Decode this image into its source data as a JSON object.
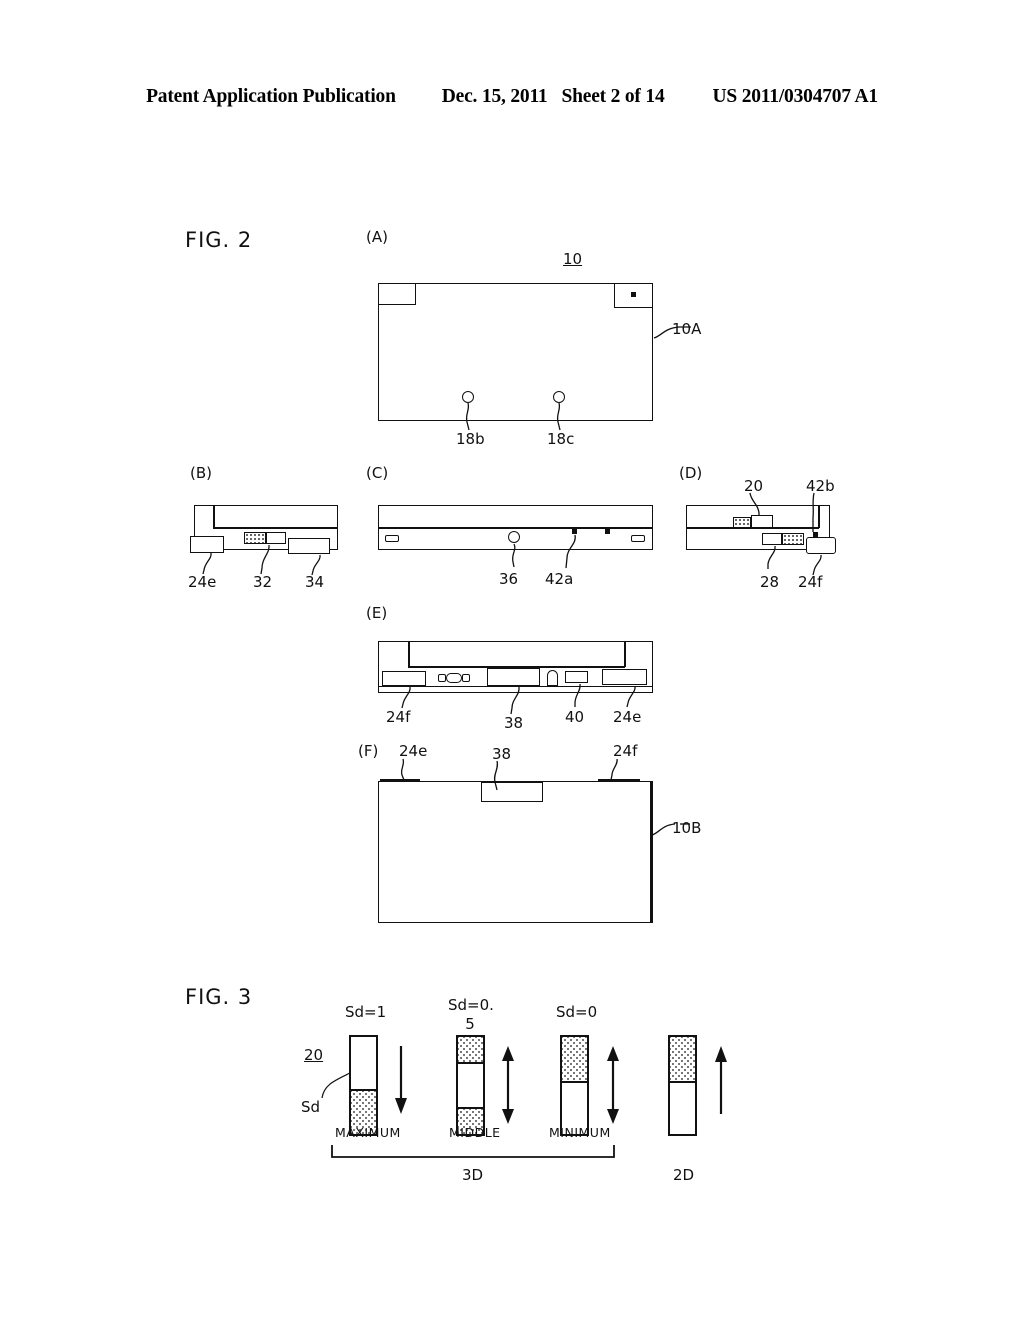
{
  "header": {
    "publication": "Patent Application Publication",
    "date": "Dec. 15, 2011",
    "sheet": "Sheet 2 of 14",
    "patent_number": "US 2011/0304707 A1"
  },
  "figures": [
    {
      "id": "fig2",
      "label": "FIG. 2",
      "panels": [
        {
          "key": "A",
          "label": "(A)",
          "refs": [
            "10",
            "10A",
            "18b",
            "18c"
          ]
        },
        {
          "key": "B",
          "label": "(B)",
          "refs": [
            "24e",
            "32",
            "34"
          ]
        },
        {
          "key": "C",
          "label": "(C)",
          "refs": [
            "36",
            "42a"
          ]
        },
        {
          "key": "D",
          "label": "(D)",
          "refs": [
            "20",
            "42b",
            "28",
            "24f"
          ]
        },
        {
          "key": "E",
          "label": "(E)",
          "refs": [
            "24f",
            "38",
            "40",
            "24e"
          ]
        },
        {
          "key": "F",
          "label": "(F)",
          "refs": [
            "24e",
            "38",
            "24f",
            "10B"
          ]
        }
      ]
    },
    {
      "id": "fig3",
      "label": "FIG. 3",
      "refs": [
        "20",
        "Sd"
      ],
      "group_labels": {
        "three_d": "3D",
        "two_d": "2D"
      },
      "sliders": [
        {
          "value_label": "Sd=1",
          "value_label_line2": "",
          "state": "MAXIMUM",
          "arrow": "down"
        },
        {
          "value_label": "Sd=0.",
          "value_label_line2": "5",
          "state": "MIDDLE",
          "arrow": "updown"
        },
        {
          "value_label": "Sd=0",
          "value_label_line2": "",
          "state": "MINIMUM",
          "arrow": "updown"
        },
        {
          "value_label": "",
          "value_label_line2": "",
          "state": "",
          "arrow": "up"
        }
      ]
    }
  ],
  "fig2": {
    "label": "FIG. 2",
    "panelA": {
      "label": "(A)",
      "ref_body": "10",
      "ref_face": "10A",
      "ref_hole_left": "18b",
      "ref_hole_right": "18c"
    },
    "panelB": {
      "label": "(B)",
      "ref_left": "24e",
      "ref_mid": "32",
      "ref_right": "34"
    },
    "panelC": {
      "label": "(C)",
      "ref_circle": "36",
      "ref_dots": "42a"
    },
    "panelD": {
      "label": "(D)",
      "ref_slider": "20",
      "ref_dot": "42b",
      "ref_connector": "28",
      "ref_right": "24f"
    },
    "panelE": {
      "label": "(E)",
      "ref_left": "24f",
      "ref_center": "38",
      "ref_small": "40",
      "ref_right": "24e"
    },
    "panelF": {
      "label": "(F)",
      "ref_left": "24e",
      "ref_center": "38",
      "ref_right": "24f",
      "ref_body": "10B"
    }
  },
  "fig3": {
    "label": "FIG. 3",
    "ref_slider": "20",
    "ref_sd": "Sd",
    "sd_max": "Sd=1",
    "sd_mid_line1": "Sd=0.",
    "sd_mid_line2": "5",
    "sd_min": "Sd=0",
    "state_max": "MAXIMUM",
    "state_mid": "MIDDLE",
    "state_min": "MINIMUM",
    "group_3d": "3D",
    "group_2d": "2D"
  },
  "colors": {
    "ink": "#111111",
    "paper": "#ffffff",
    "stipple": "#4a4a4a"
  }
}
